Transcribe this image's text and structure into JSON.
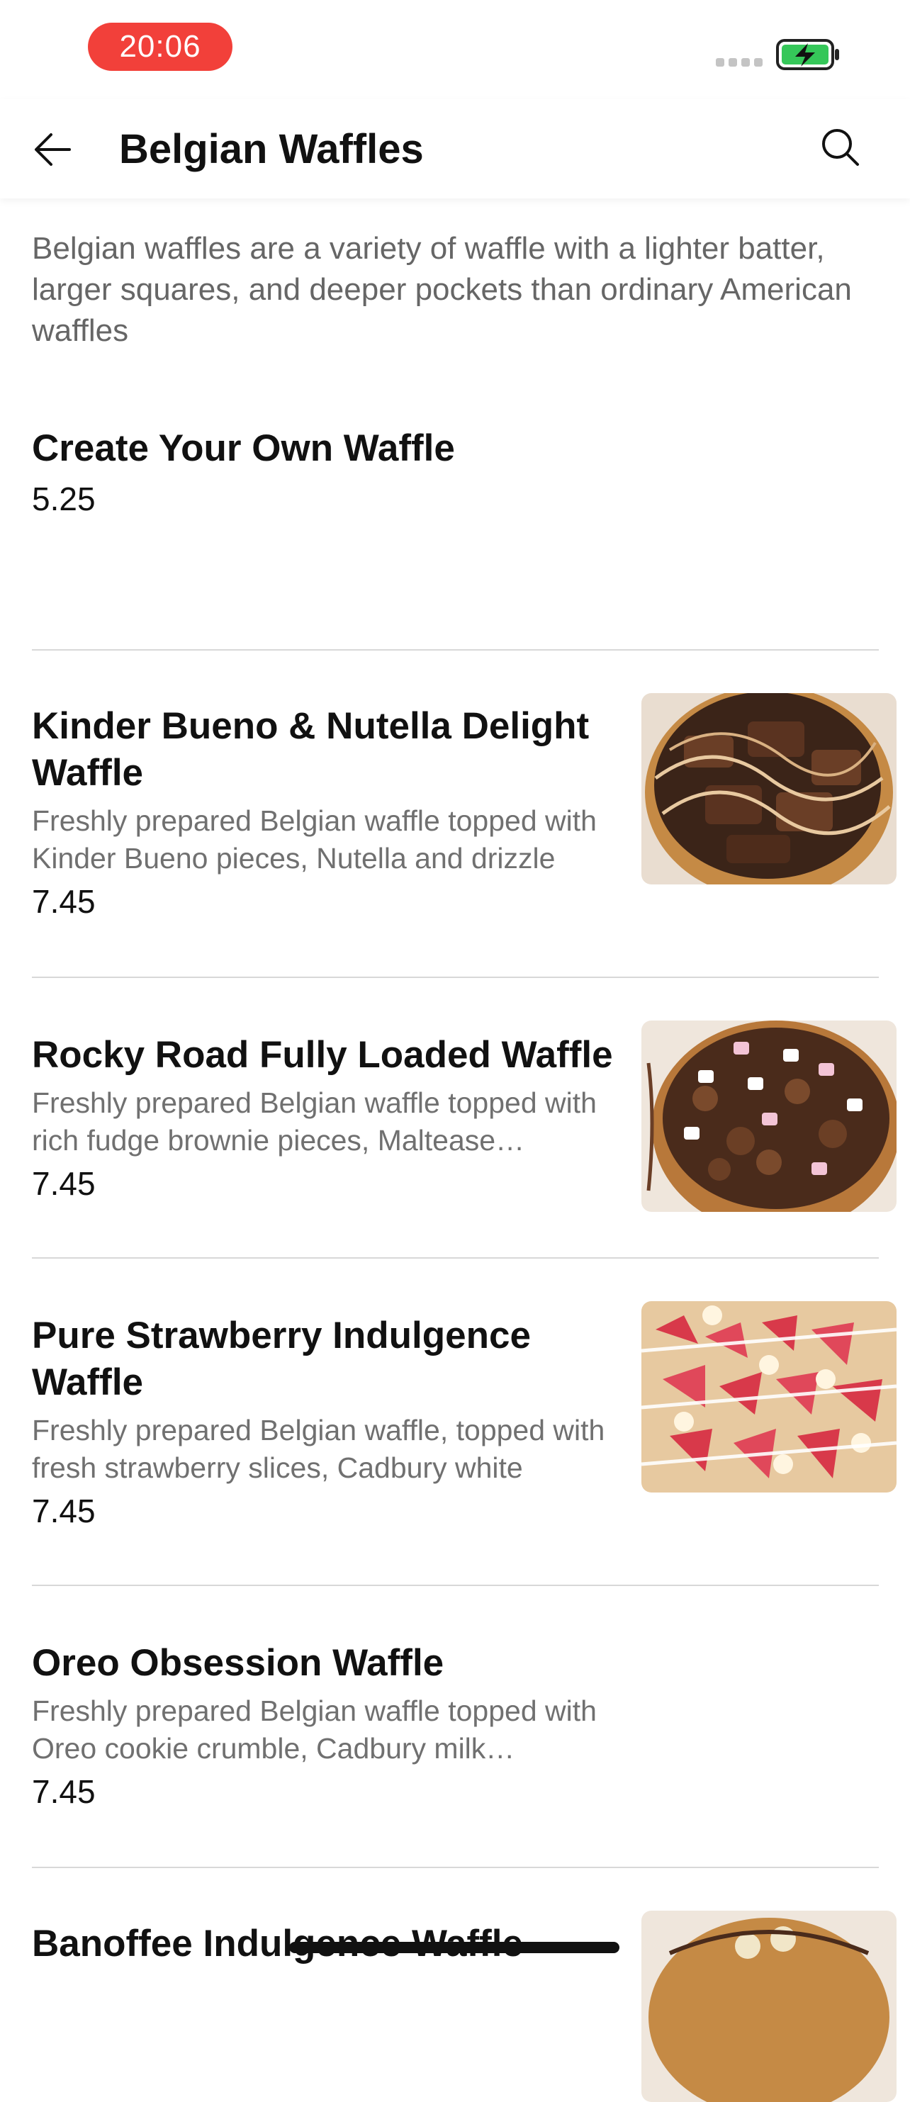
{
  "status_bar": {
    "time": "20:06",
    "battery_color": "#35c759",
    "time_pill_color": "#f2403a"
  },
  "header": {
    "title": "Belgian Waffles",
    "back_icon": "arrow-left-icon",
    "search_icon": "search-icon"
  },
  "intro": "Belgian waffles are a variety of waffle with a lighter batter, larger squares, and deeper pockets than ordinary American waffles",
  "items": [
    {
      "name": "Create Your Own Waffle",
      "description": "",
      "price": "5.25"
    },
    {
      "name": "Kinder Bueno & Nutella Delight Waffle",
      "description": "Freshly prepared Belgian waffle topped with Kinder Bueno pieces, Nutella and drizzle",
      "price": "7.45"
    },
    {
      "name": "Rocky Road Fully Loaded Waffle",
      "description": "Freshly prepared Belgian waffle topped with rich fudge brownie  pieces, Maltease…",
      "price": "7.45"
    },
    {
      "name": "Pure Strawberry Indulgence Waffle",
      "description": "Freshly prepared Belgian waffle, topped with fresh strawberry  slices, Cadbury white",
      "price": "7.45"
    },
    {
      "name": "Oreo Obsession Waffle",
      "description": "Freshly prepared Belgian waffle topped with Oreo cookie crumble, Cadbury milk…",
      "price": "7.45"
    },
    {
      "name": "Banoffee Indulgence Waffle",
      "description": "",
      "price": ""
    }
  ]
}
